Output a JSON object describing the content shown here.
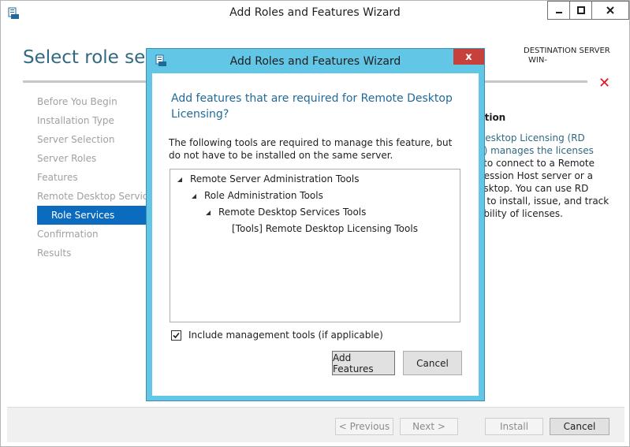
{
  "window": {
    "title": "Add Roles and Features Wizard"
  },
  "page": {
    "heading": "Select role servi",
    "destination_label": "DESTINATION SERVER",
    "destination_server": "WIN-"
  },
  "steps": [
    {
      "label": "Before You Begin",
      "active": false
    },
    {
      "label": "Installation Type",
      "active": false
    },
    {
      "label": "Server Selection",
      "active": false
    },
    {
      "label": "Server Roles",
      "active": false
    },
    {
      "label": "Features",
      "active": false
    },
    {
      "label": "Remote Desktop Services",
      "active": false
    },
    {
      "label": "Role Services",
      "active": true
    },
    {
      "label": "Confirmation",
      "active": false
    },
    {
      "label": "Results",
      "active": false
    }
  ],
  "description": {
    "title": "ption",
    "lines": [
      "Desktop Licensing (RD",
      "g) manages the licenses",
      "l to connect to a Remote",
      "Session Host server or a",
      "esktop. You can use RD",
      "g to install, issue, and track",
      "ability of licenses."
    ]
  },
  "footer": {
    "previous": "< Previous",
    "next": "Next >",
    "install": "Install",
    "cancel": "Cancel"
  },
  "dialog": {
    "title": "Add Roles and Features Wizard",
    "close_glyph": "x",
    "heading": "Add features that are required for Remote Desktop Licensing?",
    "text": "The following tools are required to manage this feature, but do not have to be installed on the same server.",
    "tree": [
      {
        "label": "Remote Server Administration Tools",
        "level": 0,
        "expander": true
      },
      {
        "label": "Role Administration Tools",
        "level": 1,
        "expander": true
      },
      {
        "label": "Remote Desktop Services Tools",
        "level": 2,
        "expander": true
      },
      {
        "label": "[Tools] Remote Desktop Licensing Tools",
        "level": 3,
        "expander": false
      }
    ],
    "include_tools_label": "Include management tools (if applicable)",
    "include_tools_checked": true,
    "add_features": "Add Features",
    "cancel": "Cancel"
  },
  "colors": {
    "accent": "#0b6cbf",
    "dialog_frame": "#62c6e6",
    "close_red": "#c6403c",
    "heading_blue": "#326982"
  }
}
